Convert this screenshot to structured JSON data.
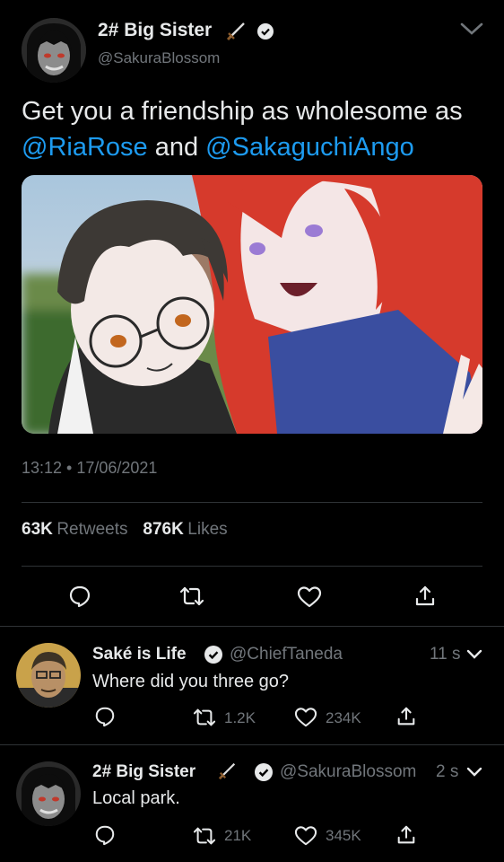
{
  "main_tweet": {
    "author_name": "2# Big Sister",
    "author_handle": "@SakuraBlossom",
    "text_before": "Get you a friendship as wholesome as ",
    "mention_1": "@RiaRose",
    "text_middle": " and ",
    "mention_2": "@SakaguchiAngo",
    "timestamp": "13:12 • 17/06/2021",
    "retweets_count": "63K",
    "retweets_label": "Retweets",
    "likes_count": "876K",
    "likes_label": "Likes"
  },
  "replies": [
    {
      "author_name": "Saké is Life",
      "author_handle": "@ChiefTaneda",
      "time": "11 s",
      "text": "Where did you three go?",
      "retweets": "1.2K",
      "likes": "234K"
    },
    {
      "author_name": "2# Big Sister",
      "author_handle": "@SakuraBlossom",
      "time": "2 s",
      "text": "Local park.",
      "retweets": "21K",
      "likes": "345K"
    }
  ],
  "colors": {
    "background": "#000000",
    "text": "#e7e9ea",
    "secondary": "#71767b",
    "link": "#1d9bf0",
    "divider": "#2f3336"
  }
}
